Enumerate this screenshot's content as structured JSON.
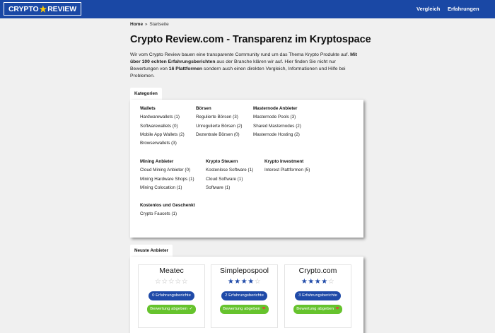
{
  "colors": {
    "nav": "#1a48a5",
    "accent_blue": "#1f4aa8",
    "accent_green": "#66c32d"
  },
  "header": {
    "logo_left": "CRYPTO",
    "logo_icon": "star-icon",
    "logo_right": "REVIEW",
    "nav": [
      {
        "label": "Vergleich"
      },
      {
        "label": "Erfahrungen"
      }
    ]
  },
  "breadcrumb": {
    "home": "Home",
    "separator": "»",
    "current": "Startseite"
  },
  "page_title": "Crypto Review.com - Transparenz im Kryptospace",
  "intro": {
    "part1": "Wir vom Crypto Review bauen eine transparente Community rund um das Thema Krypto Produkte auf.",
    "bold1": "Mit über 100 echten Erfahrungsberichten",
    "part2": "aus der Branche klären wir auf. Hier finden Sie nicht nur Bewertungen von",
    "bold2": "16 Plattformen",
    "part3": "sondern auch einen direkten Vergleich, Informationen und Hilfe bei Problemen."
  },
  "categories": {
    "tab_label": "Kategorien",
    "groups": [
      {
        "title": "Wallets",
        "items": [
          "Hardwarewallets (1)",
          "Softwarewallets (0)",
          "Mobile App Wallets (2)",
          "Browserwallets (3)"
        ]
      },
      {
        "title": "Börsen",
        "items": [
          "Regulierte Börsen (3)",
          "Unregulierte Börsen (2)",
          "Dezentrale Börsen (0)"
        ]
      },
      {
        "title": "Masternode Anbieter",
        "items": [
          "Masternode Pools (3)",
          "Shared Masternodes (2)",
          "Masternode Hosting (2)"
        ]
      },
      {
        "title": "Mining Anbieter",
        "items": [
          "Cloud Mining Anbieter (0)",
          "Mining Hardware Shops (1)",
          "Mining Colocation (1)"
        ]
      },
      {
        "title": "Krypto Steuern",
        "items": [
          "Kostenlose Software (1)",
          "Cloud Software (1)",
          "Software (1)"
        ]
      },
      {
        "title": "Krypto Investment",
        "items": [
          "Interest Plattformen (5)"
        ]
      },
      {
        "title": "Kostenlos und Geschenkt",
        "items": [
          "Crypto Faucets (1)"
        ]
      }
    ]
  },
  "providers": {
    "tab_label": "Neuste Anbieter",
    "cards": [
      {
        "name": "Meatec",
        "rating": 0,
        "max_rating": 5,
        "reports_label": "0 Erfahrungsberichte",
        "rate_label": "Bewertung abgeben",
        "rate_icon": "check-icon"
      },
      {
        "name": "Simplepospool",
        "rating": 4,
        "max_rating": 5,
        "reports_label": "2 Erfahrungsberichte",
        "rate_label": "Bewertung abgeben",
        "rate_icon": "heart-icon"
      },
      {
        "name": "Crypto.com",
        "rating": 4,
        "max_rating": 5,
        "reports_label": "3 Erfahrungsberichte",
        "rate_label": "Bewertung abgeben",
        "rate_icon": "heart-icon"
      }
    ]
  }
}
